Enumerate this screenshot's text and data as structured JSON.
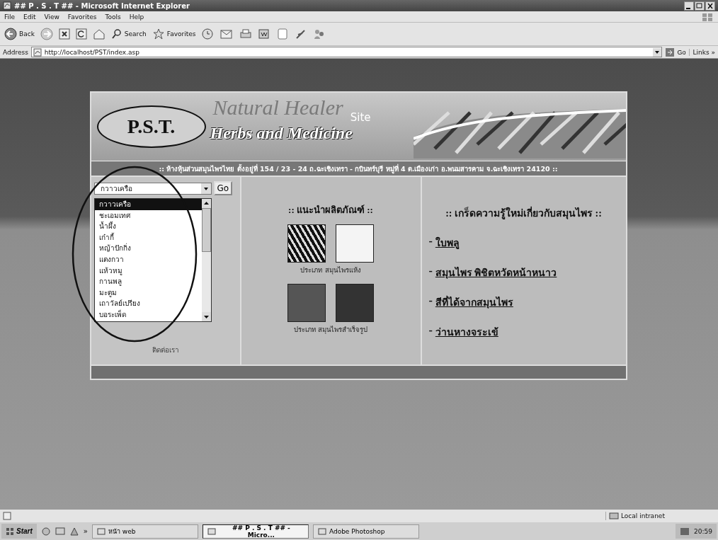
{
  "window": {
    "title": "## P . S . T ## - Microsoft Internet Explorer"
  },
  "menu": [
    "File",
    "Edit",
    "View",
    "Favorites",
    "Tools",
    "Help"
  ],
  "toolbar": {
    "back": "Back",
    "search": "Search",
    "favorites": "Favorites"
  },
  "address_bar": {
    "label": "Address",
    "url": "http://localhost/PST/index.asp",
    "go": "Go",
    "links": "Links »"
  },
  "page": {
    "banner": {
      "logo": "P.S.T.",
      "background_text": "Natural Healer",
      "title": "Herbs and Medicine",
      "site": "Site"
    },
    "address_line": ":: ห้างหุ้นส่วนสมุนไพรไทย ตั้งอยู่ที่ 154 / 23 - 24 ถ.ฉะเชิงเทรา - กบินทร์บุรี หมู่ที่ 4 ต.เมืองเก่า อ.พนมสารคาม จ.ฉะเชิงเทรา 24120 ::",
    "herb_dropdown": {
      "value": "กวาวเครือ",
      "go": "Go",
      "options": [
        {
          "label": "กวาวเครือ",
          "selected": true
        },
        {
          "label": "ชะเอมเทศ",
          "selected": false
        },
        {
          "label": "น้ำผึ้ง",
          "selected": false
        },
        {
          "label": "เก๋ากี้",
          "selected": false
        },
        {
          "label": "หญ้าปักกิ่ง",
          "selected": false
        },
        {
          "label": "แตงกวา",
          "selected": false
        },
        {
          "label": "แห้วหมู",
          "selected": false
        },
        {
          "label": "กานพลู",
          "selected": false
        },
        {
          "label": "มะตูม",
          "selected": false
        },
        {
          "label": "เถาวัลย์เปรียง",
          "selected": false
        },
        {
          "label": "บอระเพ็ด",
          "selected": false
        }
      ]
    },
    "contact": "ติดต่อเรา",
    "products": {
      "heading": ":: แนะนำผลิตภัณฑ์ ::",
      "groups": [
        {
          "caption": "ประเภท สมุนไพรแห้ง"
        },
        {
          "caption": "ประเภท สมุนไพรสำเร็จรูป"
        }
      ]
    },
    "tips": {
      "heading": ":: เกร็ดความรู้ใหม่เกี่ยวกับสมุนไพร ::",
      "links": [
        {
          "bullet": "-",
          "label": "ใบพลู"
        },
        {
          "bullet": "-",
          "label": "สมุนไพร พิชิตหวัดหน้าหนาว"
        },
        {
          "bullet": "-",
          "label": "สีที่ได้จากสมุนไพร"
        },
        {
          "bullet": "-",
          "label": "ว่านหางจระเข้"
        }
      ]
    }
  },
  "status_bar": {
    "zone": "Local intranet"
  },
  "taskbar": {
    "start": "Start",
    "more": "»",
    "items": [
      {
        "label": "หน้า web",
        "selected": false
      },
      {
        "label": "## P . S . T ## - Micro...",
        "selected": true
      },
      {
        "label": "Adobe Photoshop",
        "selected": false
      }
    ],
    "clock": "20:59"
  }
}
